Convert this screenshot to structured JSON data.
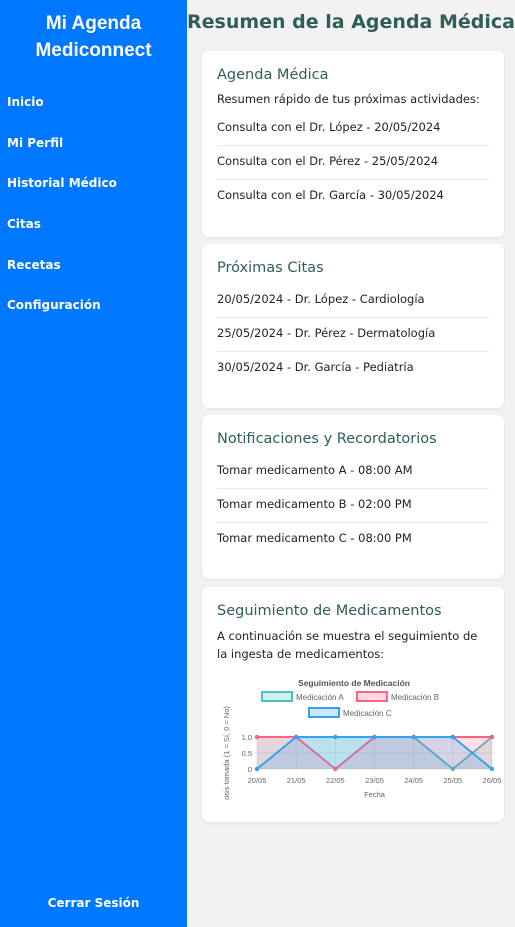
{
  "sidebar": {
    "brand_line1": "Mi Agenda",
    "brand_line2": "Mediconnect",
    "items": [
      "Inicio",
      "Mi Perfil",
      "Historial Médico",
      "Citas",
      "Recetas",
      "Configuración"
    ],
    "logout": "Cerrar Sesión"
  },
  "main": {
    "title": "Resumen de la Agenda Médica",
    "agenda": {
      "title": "Agenda Médica",
      "intro": "Resumen rápido de tus próximas actividades:",
      "items": [
        "Consulta con el Dr. López - 20/05/2024",
        "Consulta con el Dr. Pérez - 25/05/2024",
        "Consulta con el Dr. García - 30/05/2024"
      ]
    },
    "citas": {
      "title": "Próximas Citas",
      "items": [
        "20/05/2024 - Dr. López - Cardiología",
        "25/05/2024 - Dr. Pérez - Dermatología",
        "30/05/2024 - Dr. García - Pediatría"
      ]
    },
    "notificaciones": {
      "title": "Notificaciones y Recordatorios",
      "items": [
        "Tomar medicamento A - 08:00 AM",
        "Tomar medicamento B - 02:00 PM",
        "Tomar medicamento C - 08:00 PM"
      ]
    },
    "seguimiento": {
      "title": "Seguimiento de Medicamentos",
      "intro": "A continuación se muestra el seguimiento de la ingesta de medicamentos:"
    }
  },
  "chart_data": {
    "type": "line",
    "title": "Seguimiento de Medicación",
    "xlabel": "Fecha",
    "ylabel": "osis tomada (1 = Sí, 0 = No)",
    "categories": [
      "20/05",
      "21/05",
      "22/05",
      "23/05",
      "24/05",
      "25/05",
      "26/05"
    ],
    "yticks": [
      "0",
      "0.5",
      "1.0"
    ],
    "ylim": [
      0,
      1
    ],
    "legend": "top",
    "fill": true,
    "series": [
      {
        "name": "Medicación A",
        "values": [
          1,
          1,
          1,
          1,
          1,
          0,
          1
        ],
        "color": "#4bc0c0"
      },
      {
        "name": "Medicación B",
        "values": [
          1,
          1,
          0,
          1,
          1,
          1,
          1
        ],
        "color": "#ff6384"
      },
      {
        "name": "Medicación C",
        "values": [
          0,
          1,
          1,
          1,
          1,
          1,
          0
        ],
        "color": "#36a2eb"
      }
    ]
  }
}
